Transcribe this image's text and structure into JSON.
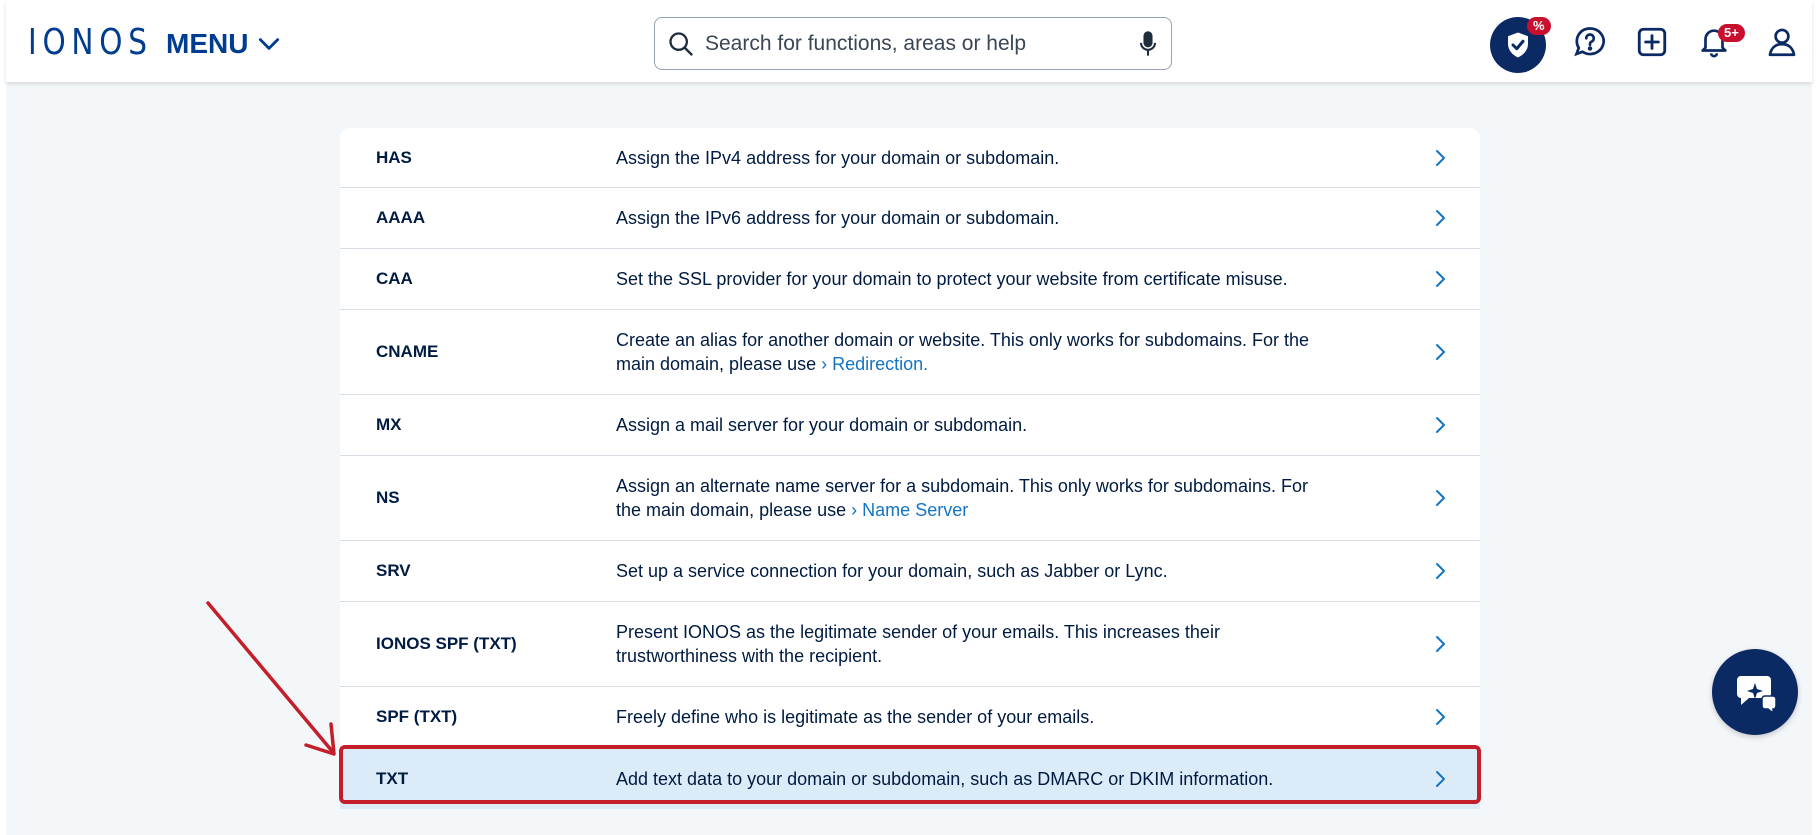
{
  "header": {
    "logo": "IONOS",
    "menu_label": "MENU",
    "search_placeholder": "Search for functions, areas or help",
    "shield_badge": "%",
    "notifications_badge": "5+"
  },
  "records": [
    {
      "type": "HAS",
      "desc": "Assign the IPv4 address for your domain or subdomain."
    },
    {
      "type": "AAAA",
      "desc": "Assign the IPv6 address for your domain or subdomain."
    },
    {
      "type": "CAA",
      "desc": "Set the SSL provider for your domain to protect your website from certificate misuse."
    },
    {
      "type": "CNAME",
      "desc_line1": "Create an alias for another domain or website. This only works for subdomains. For the",
      "desc_line2": "main domain, please use",
      "link": "Redirection."
    },
    {
      "type": "MX",
      "desc": "Assign a mail server for your domain or subdomain."
    },
    {
      "type": "NS",
      "desc_line1": "Assign an alternate name server for a subdomain. This only works for subdomains. For",
      "desc_line2": "the main domain, please use",
      "link": "Name Server"
    },
    {
      "type": "SRV",
      "desc": "Set up a service connection for your domain, such as Jabber or Lync."
    },
    {
      "type": "IONOS SPF (TXT)",
      "desc_line1": "Present IONOS as the legitimate sender of your emails. This increases their",
      "desc_line2": "trustworthiness with the recipient."
    },
    {
      "type": "SPF (TXT)",
      "desc": "Freely define who is legitimate as the sender of your emails."
    },
    {
      "type": "TXT",
      "desc": "Add text data to your domain or subdomain, such as DMARC or DKIM information."
    }
  ],
  "colors": {
    "brand": "#003d8f",
    "link": "#1474c4",
    "highlight": "#c41e2a",
    "selected_row": "#dcebf8",
    "badge": "#c8102e"
  },
  "selected_record": "TXT"
}
